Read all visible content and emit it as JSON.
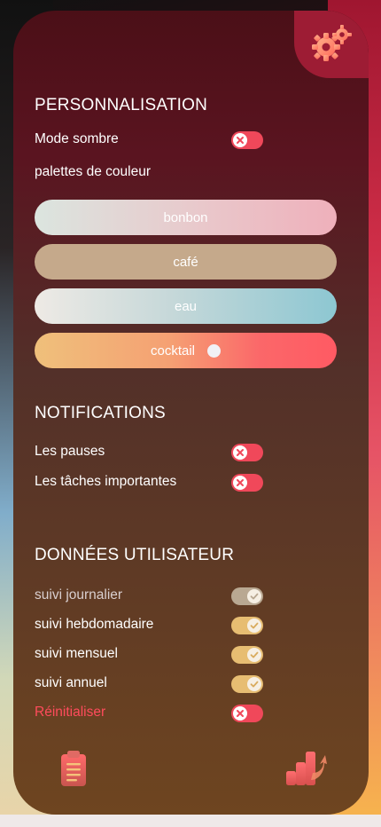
{
  "settings": {
    "icon": "gear-icon"
  },
  "personalisation": {
    "title": "PERSONNALISATION",
    "dark_mode_label": "Mode sombre",
    "palettes_label": "palettes de couleur",
    "palettes": [
      {
        "label": "bonbon"
      },
      {
        "label": "café"
      },
      {
        "label": "eau"
      },
      {
        "label": "cocktail"
      }
    ]
  },
  "notifications": {
    "title": "NOTIFICATIONS",
    "items": [
      {
        "label": "Les pauses"
      },
      {
        "label": "Les tâches importantes"
      }
    ]
  },
  "user_data": {
    "title": "DONNÉES UTILISATEUR",
    "items": [
      {
        "label": "suivi journalier"
      },
      {
        "label": "suivi hebdomadaire"
      },
      {
        "label": "suivi mensuel"
      },
      {
        "label": "suivi annuel"
      }
    ],
    "reset_label": "Réinitialiser"
  },
  "bottom_nav": {
    "left_icon": "clipboard-icon",
    "right_icon": "chart-icon"
  },
  "colors": {
    "accent": "#9d1c34",
    "toggle_off": "#f0485a",
    "toggle_on": "#e7bd72",
    "danger": "#ff4b5c"
  }
}
